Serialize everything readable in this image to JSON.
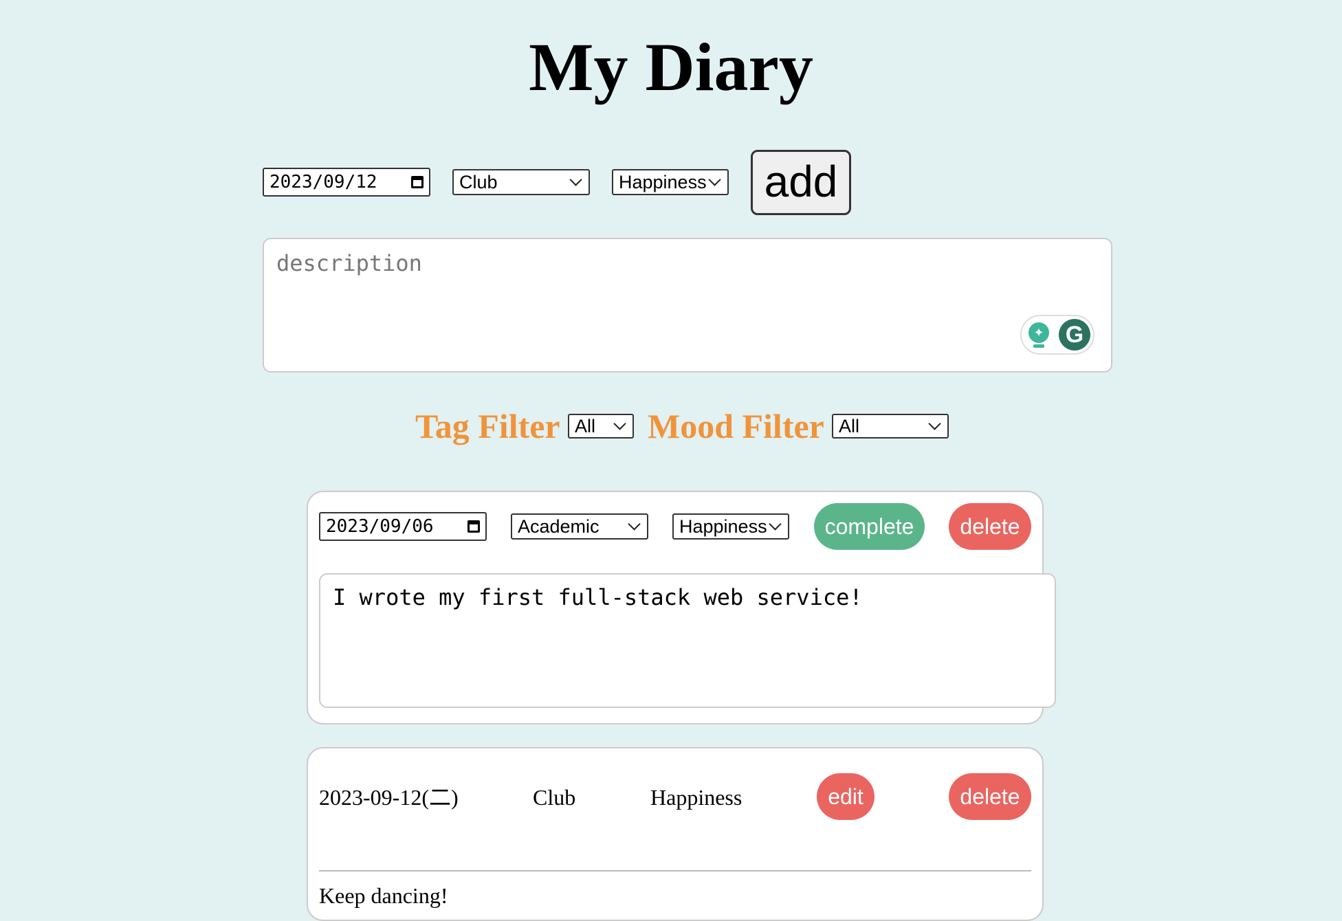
{
  "app": {
    "title": "My Diary"
  },
  "new_entry": {
    "date": "2023/09/12",
    "tag": "Club",
    "mood": "Happiness",
    "add_label": "add",
    "description_placeholder": "description"
  },
  "filters": {
    "tag_label": "Tag Filter",
    "tag_value": "All",
    "mood_label": "Mood Filter",
    "mood_value": "All"
  },
  "entries": [
    {
      "mode": "editing",
      "date": "2023/09/06",
      "tag": "Academic",
      "mood": "Happiness",
      "primary_action": "complete",
      "delete_label": "delete",
      "text": "I wrote my first full-stack web service!"
    },
    {
      "mode": "view",
      "date": "2023-09-12(二)",
      "tag": "Club",
      "mood": "Happiness",
      "primary_action": "edit",
      "delete_label": "delete",
      "text": "Keep dancing!"
    }
  ],
  "colors": {
    "background": "#e2f1f2",
    "filter_label": "#f0943b",
    "complete_button": "#5bb58b",
    "delete_button": "#ea6560"
  },
  "icons": {
    "date_picker": "calendar-icon",
    "select": "chevron-down-icon",
    "writing_assistant": [
      "lightbulb-icon",
      "grammarly-icon"
    ]
  }
}
